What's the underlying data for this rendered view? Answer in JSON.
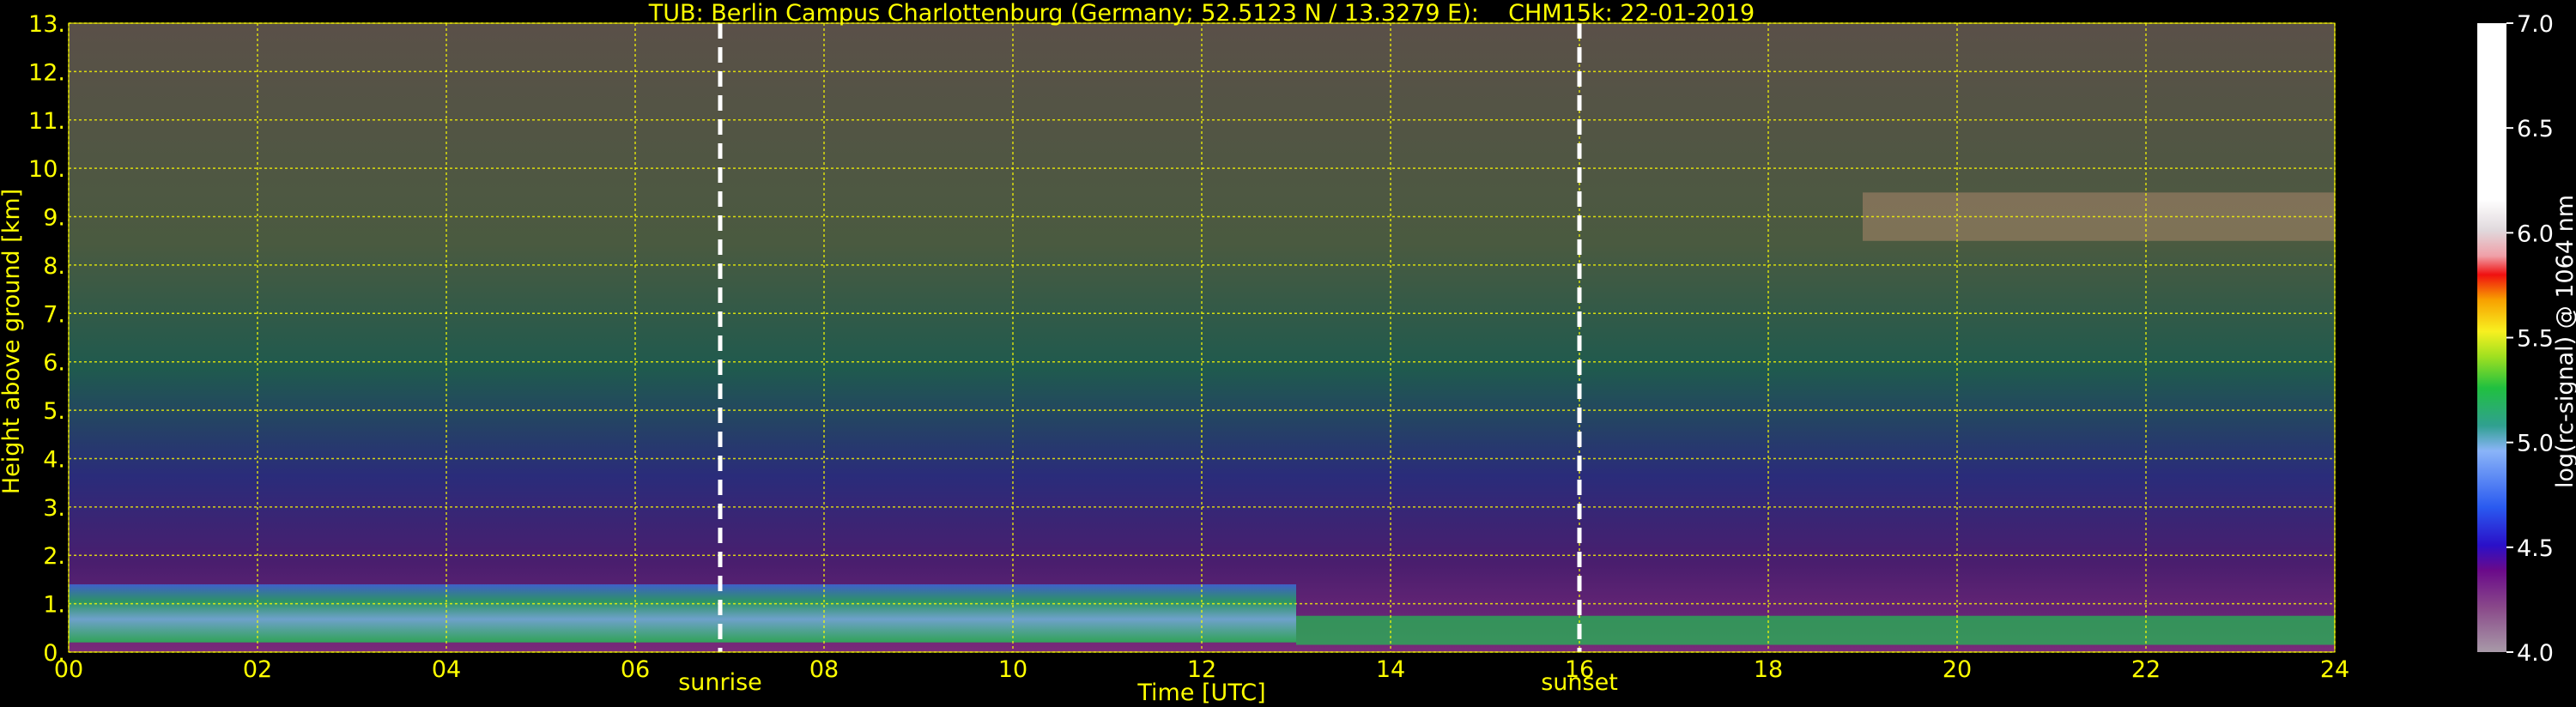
{
  "chart_data": {
    "type": "heatmap",
    "title": "TUB: Berlin Campus Charlottenburg (Germany; 52.5123 N / 13.3279 E):    CHM15k: 22-01-2019",
    "xlabel": "Time [UTC]",
    "ylabel": "Height above ground [km]",
    "xlim": [
      0,
      24
    ],
    "ylim": [
      0,
      13
    ],
    "x_ticks": [
      "00",
      "02",
      "04",
      "06",
      "08",
      "10",
      "12",
      "14",
      "16",
      "18",
      "20",
      "22",
      "24"
    ],
    "y_ticks": [
      "0.",
      "1.",
      "2.",
      "3.",
      "4.",
      "5.",
      "6.",
      "7.",
      "8.",
      "9.",
      "10.",
      "11.",
      "12.",
      "13."
    ],
    "grid": true,
    "markers": [
      {
        "label": "sunrise",
        "x": 6.9
      },
      {
        "label": "sunset",
        "x": 16.0
      }
    ],
    "colorbar": {
      "label": "log(rc-signal) @ 1064 nm",
      "range": [
        4.0,
        7.0
      ],
      "ticks": [
        "4.0",
        "4.5",
        "5.0",
        "5.5",
        "6.0",
        "6.5",
        "7.0"
      ]
    },
    "colors": {
      "text": "#ffff00",
      "grid": "#ffff00",
      "background": "#000000"
    }
  }
}
